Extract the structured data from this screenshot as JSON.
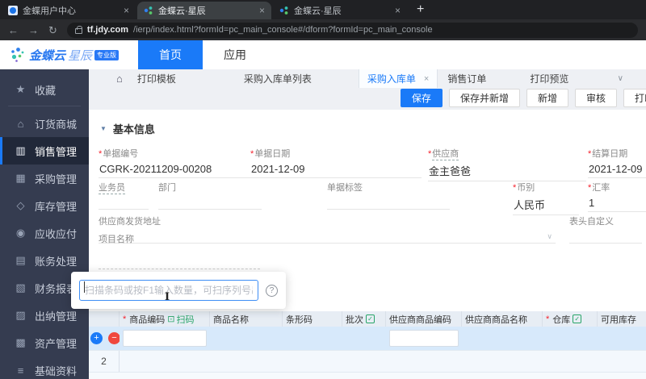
{
  "colors": {
    "accent": "#1a7af8",
    "green": "#27a468",
    "required_red": "#f5222d",
    "sidebar_bg": "#353c50"
  },
  "icons": {
    "close": "×",
    "new_tab": "+",
    "back": "←",
    "forward": "→",
    "reload": "↻",
    "chevron_down": "∨",
    "home": "⌂",
    "help": "?",
    "collapse_triangle": "▼",
    "check": "✓",
    "scan": "⊡",
    "add": "+",
    "remove": "−",
    "text_cursor": "I"
  },
  "browser": {
    "tabs": [
      {
        "title": "金蝶用户中心"
      },
      {
        "title": "金蝶云·星辰"
      },
      {
        "title": "金蝶云·星辰"
      }
    ],
    "url": {
      "domain": "tf.jdy.com",
      "path": "/ierp/index.html?formId=pc_main_console#/dform?formId=pc_main_console"
    }
  },
  "header": {
    "logo": {
      "main": "金蝶云",
      "sub": "星辰",
      "badge": "专业版"
    },
    "nav": [
      {
        "label": "首页"
      },
      {
        "label": "应用"
      }
    ]
  },
  "sidebar": {
    "items": [
      {
        "label": "收藏",
        "icon": "★"
      },
      {
        "label": "订货商城",
        "icon": "⌂"
      },
      {
        "label": "销售管理",
        "icon": "▥"
      },
      {
        "label": "采购管理",
        "icon": "▦"
      },
      {
        "label": "库存管理",
        "icon": "◇"
      },
      {
        "label": "应收应付",
        "icon": "◉"
      },
      {
        "label": "账务处理",
        "icon": "▤"
      },
      {
        "label": "财务报表",
        "icon": "▧"
      },
      {
        "label": "出纳管理",
        "icon": "▨"
      },
      {
        "label": "资产管理",
        "icon": "▩"
      },
      {
        "label": "基础资料",
        "icon": "≡"
      }
    ]
  },
  "doc_tabs": [
    {
      "label": "打印模板"
    },
    {
      "label": "采购入库单列表"
    },
    {
      "label": "采购入库单"
    },
    {
      "label": "销售订单"
    },
    {
      "label": "打印预览"
    }
  ],
  "actions": [
    {
      "label": "保存"
    },
    {
      "label": "保存并新增"
    },
    {
      "label": "新增"
    },
    {
      "label": "审核"
    },
    {
      "label": "打印"
    }
  ],
  "form": {
    "section_title": "基本信息",
    "required_marker": "*",
    "bill_no": {
      "label": "单据编号",
      "value": "CGRK-20211209-00208"
    },
    "bill_date": {
      "label": "单据日期",
      "value": "2021-12-09"
    },
    "supplier": {
      "label": "供应商",
      "value": "金主爸爸"
    },
    "settle_date": {
      "label": "结算日期",
      "value": "2021-12-09"
    },
    "salesman": {
      "label": "业务员",
      "value": ""
    },
    "department": {
      "label": "部门",
      "value": ""
    },
    "bill_tag": {
      "label": "单据标签",
      "value": ""
    },
    "currency": {
      "label": "币别",
      "value": "人民币"
    },
    "exchange_rate": {
      "label": "汇率",
      "value": "1"
    },
    "supplier_addr": {
      "label": "供应商发货地址",
      "value": ""
    },
    "header_custom": {
      "label": "表头自定义"
    },
    "project_name": {
      "label": "项目名称",
      "value": ""
    }
  },
  "scan_popup": {
    "placeholder": "扫描条码或按F1输入数量，可扫序列号出库"
  },
  "table": {
    "columns": [
      {
        "label": "商品编码",
        "extra": "扫码"
      },
      {
        "label": "商品名称"
      },
      {
        "label": "条形码"
      },
      {
        "label": "批次"
      },
      {
        "label": "供应商商品编码"
      },
      {
        "label": "供应商商品名称"
      },
      {
        "label": "仓库"
      },
      {
        "label": "可用库存"
      }
    ],
    "rows": [
      {
        "num": ""
      },
      {
        "num": "2"
      }
    ]
  }
}
